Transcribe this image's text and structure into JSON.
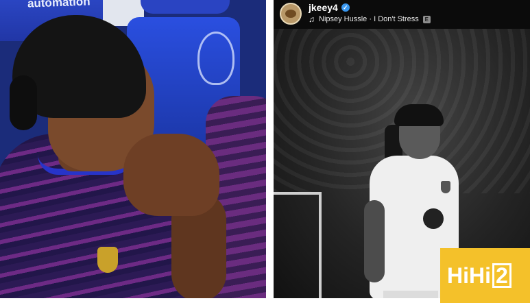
{
  "left_photo": {
    "seat_text": "automation"
  },
  "post": {
    "username": "jkeey4",
    "verified": true,
    "music": {
      "artist": "Nipsey Hussle",
      "separator": " · ",
      "track": "I Don't Stress",
      "explicit_badge": "E"
    },
    "icons": {
      "music": "music-note-icon",
      "verified": "verified-badge-icon"
    }
  },
  "watermark": {
    "prefix": "HiHi",
    "suffix": "2"
  },
  "colors": {
    "verified": "#3897f0",
    "watermark_bg": "#f4c12a",
    "header_bg": "#0b0b0b"
  }
}
